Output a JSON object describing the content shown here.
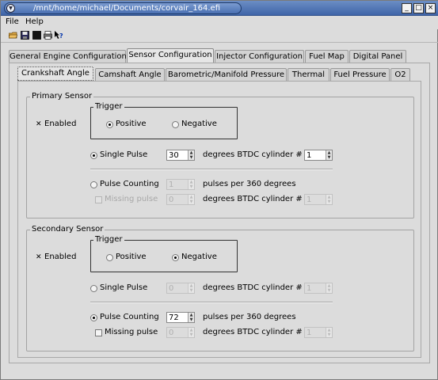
{
  "window": {
    "title": "/mnt/home/michael/Documents/corvair_164.efi"
  },
  "menubar": {
    "file": "File",
    "help": "Help"
  },
  "toolbar": {
    "icons": [
      "open-folder-icon",
      "save-icon",
      "stop-icon",
      "print-icon",
      "help-pointer-icon"
    ]
  },
  "tabs": {
    "main": [
      "General Engine Configuration",
      "Sensor Configuration",
      "Injector Configuration",
      "Fuel Map",
      "Digital Panel"
    ],
    "main_selected": "Sensor Configuration",
    "sub": [
      "Crankshaft Angle",
      "Camshaft Angle",
      "Barometric/Manifold Pressure",
      "Thermal",
      "Fuel Pressure",
      "O2"
    ],
    "sub_selected": "Crankshaft Angle"
  },
  "primary": {
    "title": "Primary Sensor",
    "enabled_label": "Enabled",
    "enabled": true,
    "trigger_title": "Trigger",
    "positive_label": "Positive",
    "negative_label": "Negative",
    "trigger_selected": "Positive",
    "single_pulse_label": "Single Pulse",
    "single_pulse_value": "30",
    "degrees_btdc_label": "degrees BTDC cylinder #",
    "cylinder_value": "1",
    "pulse_counting_label": "Pulse Counting",
    "pulse_counting_value": "1",
    "pulses_per_label": "pulses per 360 degrees",
    "missing_pulse_label": "Missing pulse",
    "missing_pulse_value": "0",
    "missing_degrees_label": "degrees BTDC cylinder #",
    "missing_cylinder_value": "1",
    "mode_selected": "Single Pulse"
  },
  "secondary": {
    "title": "Secondary Sensor",
    "enabled_label": "Enabled",
    "enabled": true,
    "trigger_title": "Trigger",
    "positive_label": "Positive",
    "negative_label": "Negative",
    "trigger_selected": "Negative",
    "single_pulse_label": "Single Pulse",
    "single_pulse_value": "0",
    "degrees_btdc_label": "degrees BTDC cylinder #",
    "cylinder_value": "1",
    "pulse_counting_label": "Pulse Counting",
    "pulse_counting_value": "72",
    "pulses_per_label": "pulses per 360 degrees",
    "missing_pulse_label": "Missing pulse",
    "missing_pulse_value": "0",
    "missing_degrees_label": "degrees BTDC cylinder #",
    "missing_cylinder_value": "1",
    "mode_selected": "Pulse Counting"
  },
  "colors": {
    "titlebar": "#4a70b2",
    "window_bg": "#dcdcdc"
  }
}
